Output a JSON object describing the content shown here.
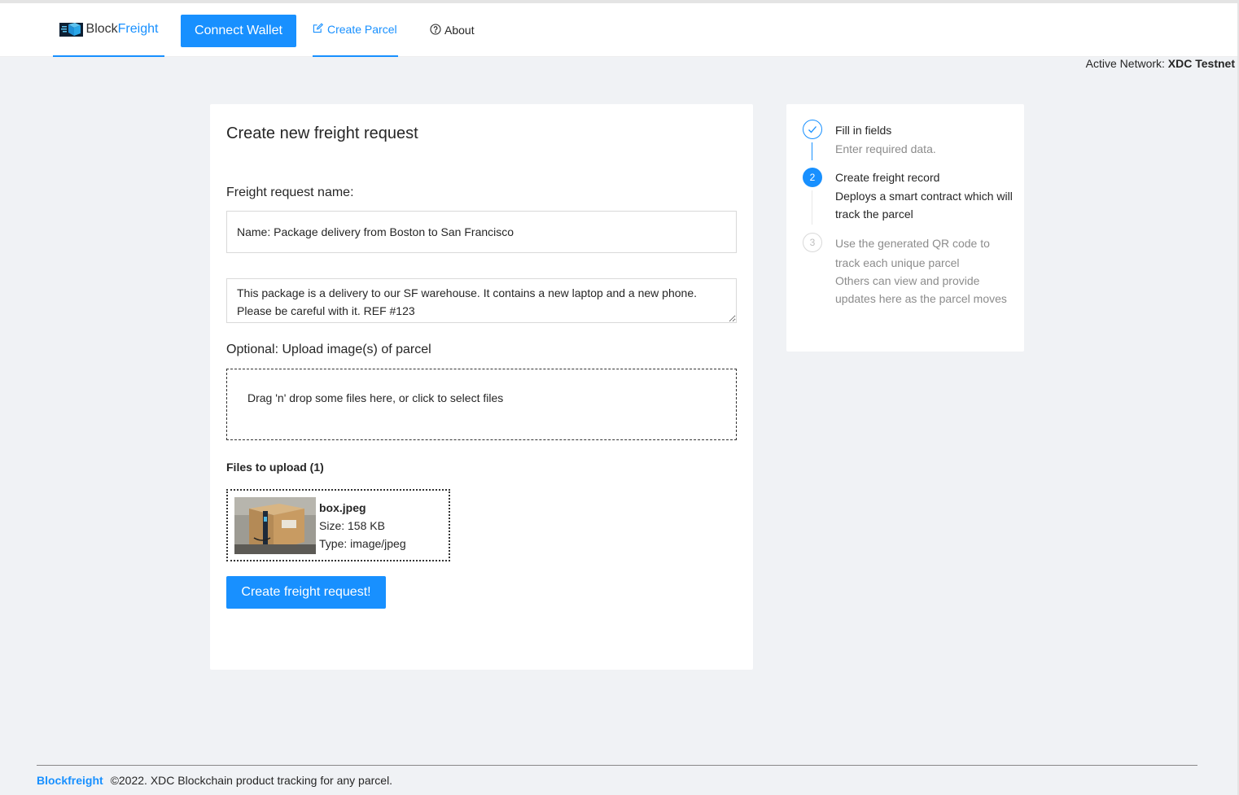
{
  "header": {
    "logo": {
      "text_dark": "Block",
      "text_blue": "Freight"
    },
    "connect_label": "Connect Wallet",
    "nav": [
      {
        "label": "Create Parcel",
        "icon": "edit-icon"
      },
      {
        "label": "About",
        "icon": "question-circle-icon"
      }
    ],
    "network_label": "Active Network:",
    "network_value": "XDC Testnet"
  },
  "form": {
    "title": "Create new freight request",
    "name_label": "Freight request name:",
    "name_value": "Name: Package delivery from Boston to San Francisco",
    "description_value": "This package is a delivery to our SF warehouse. It contains a new laptop and a new phone. Please be careful with it. REF #123",
    "upload_label": "Optional: Upload image(s) of parcel",
    "dropzone_text": "Drag 'n' drop some files here, or click to select files",
    "files_title": "Files to upload (1)",
    "files": [
      {
        "name": "box.jpeg",
        "size": "Size: 158 KB",
        "type": "Type: image/jpeg"
      }
    ],
    "submit_label": "Create freight request!"
  },
  "steps": [
    {
      "num": "1",
      "status": "finished",
      "title": "Fill in fields",
      "desc": "Enter required data."
    },
    {
      "num": "2",
      "status": "active",
      "title": "Create freight record",
      "desc": "Deploys a smart contract which will track the parcel"
    },
    {
      "num": "3",
      "status": "waiting",
      "title": "Use the generated QR code to track each unique parcel",
      "desc": "Others can view and provide updates here as the parcel moves"
    }
  ],
  "footer": {
    "brand": "Blockfreight",
    "text": "©2022. XDC Blockchain product tracking for any parcel."
  },
  "colors": {
    "primary": "#1890ff",
    "background": "#f0f2f5"
  }
}
